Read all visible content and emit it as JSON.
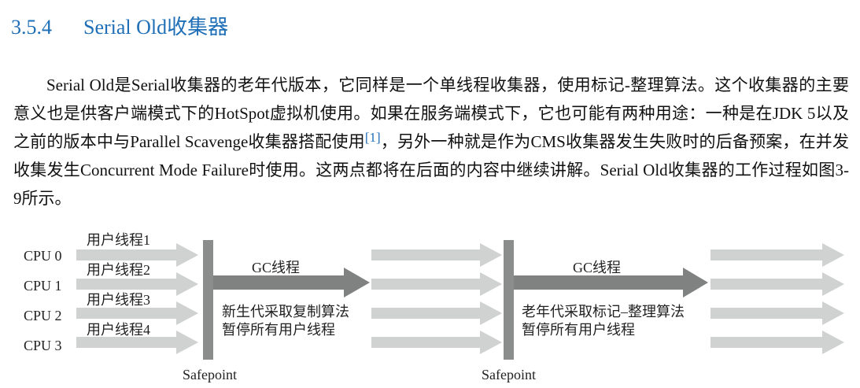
{
  "section": {
    "number": "3.5.4",
    "title": "Serial Old收集器"
  },
  "paragraph": {
    "part1": "Serial Old是Serial收集器的老年代版本，它同样是一个单线程收集器，使用标记-整理算法。这个收集器的主要意义也是供客户端模式下的HotSpot虚拟机使用。如果在服务端模式下，它也可能有两种用途：一种是在JDK 5以及之前的版本中与Parallel Scavenge收集器搭配使用",
    "footnote": "[1]",
    "part2": "，另外一种就是作为CMS收集器发生失败时的后备预案，在并发收集发生Concurrent Mode Failure时使用。这两点都将在后面的内容中继续讲解。Serial Old收集器的工作过程如图3-9所示。"
  },
  "figure": {
    "cpus": [
      "CPU 0",
      "CPU 1",
      "CPU 2",
      "CPU 3"
    ],
    "user_threads": [
      "用户线程1",
      "用户线程2",
      "用户线程3",
      "用户线程4"
    ],
    "phase1": {
      "gc_label": "GC线程",
      "desc_line1": "新生代采取复制算法",
      "desc_line2": "暂停所有用户线程",
      "safepoint": "Safepoint"
    },
    "phase2": {
      "gc_label": "GC线程",
      "desc_line1": "老年代采取标记–整理算法",
      "desc_line2": "暂停所有用户线程",
      "safepoint": "Safepoint"
    },
    "colors": {
      "arrow_light": "#cfd2d1",
      "arrow_dark": "#7f8281",
      "barrier": "#8a8d8c",
      "heading": "#1f6fb7"
    }
  }
}
